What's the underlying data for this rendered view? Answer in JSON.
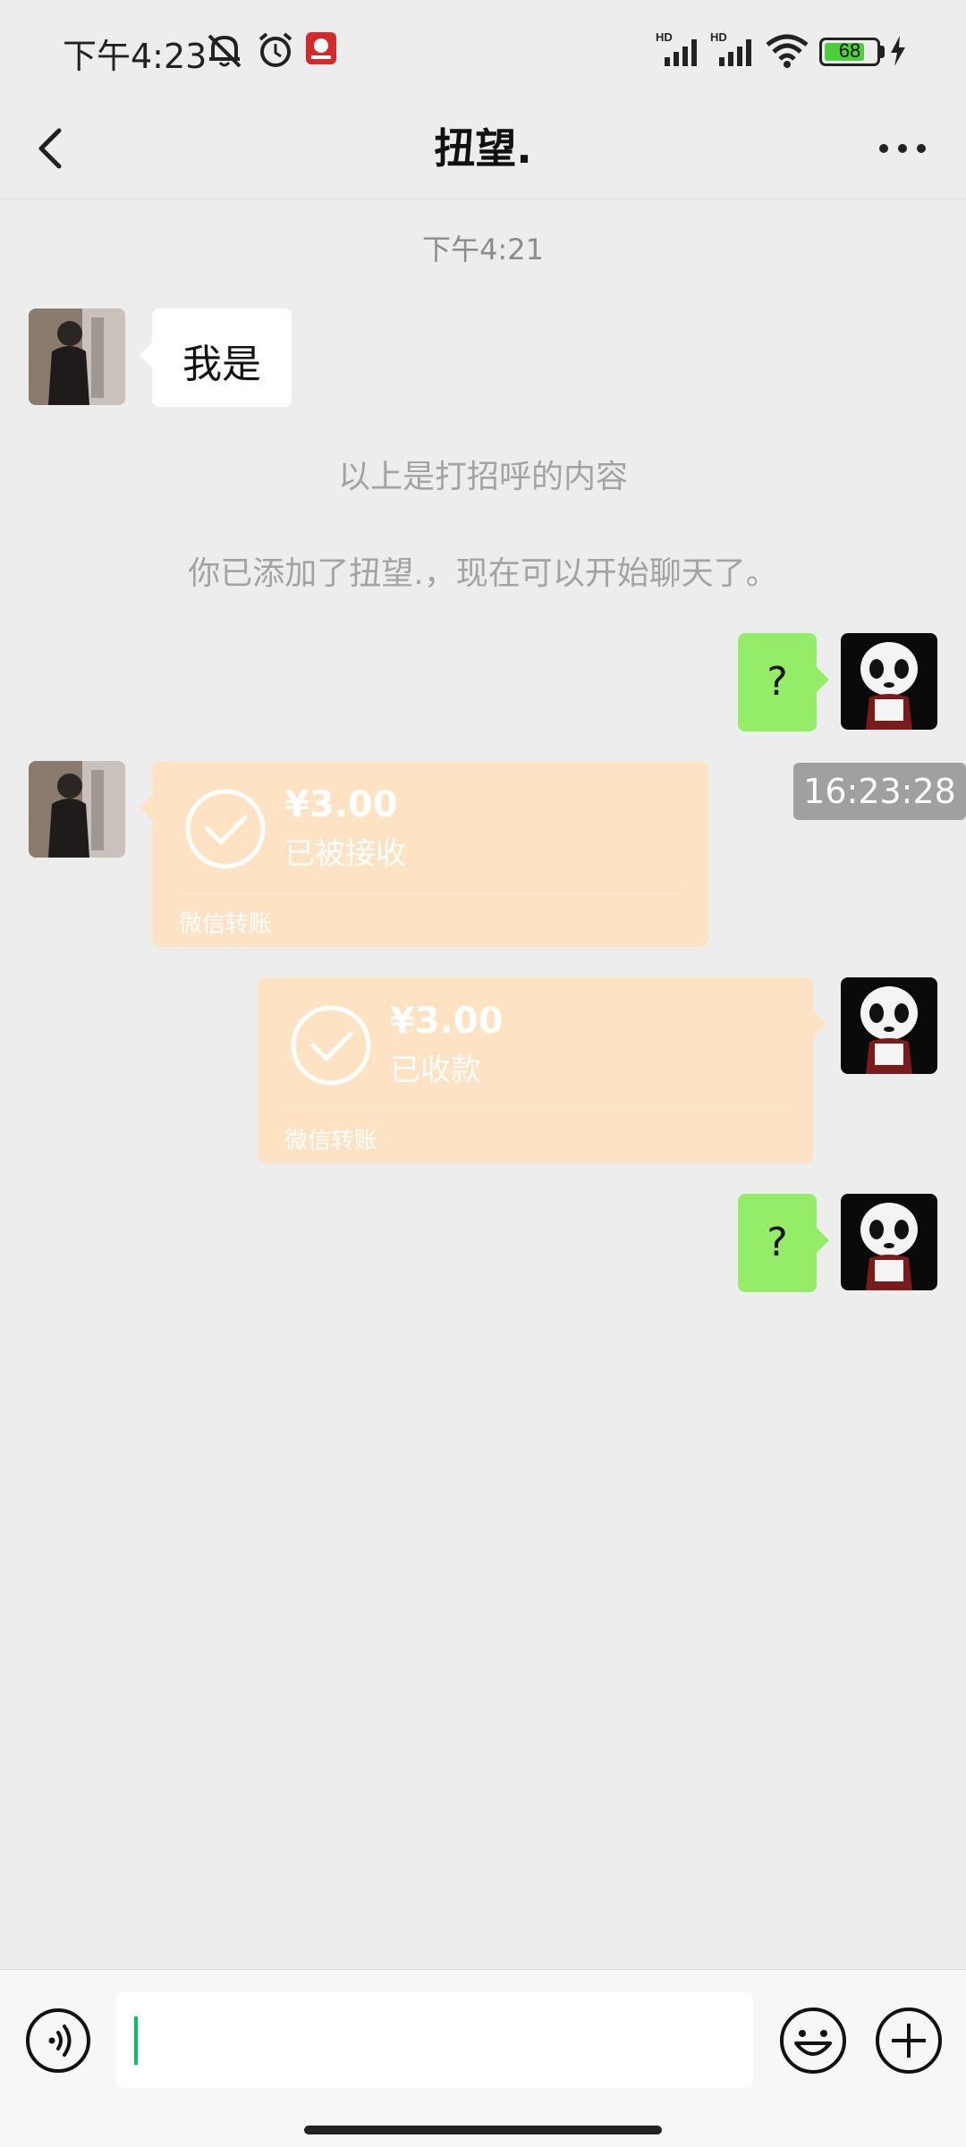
{
  "status_bar": {
    "time": "下午4:23",
    "network_1": "HD",
    "network_2": "HD",
    "battery": "68",
    "icons": [
      "mute-icon",
      "alarm-icon",
      "app-badge-icon",
      "signal-icon",
      "wifi-icon",
      "battery-icon",
      "charging-icon"
    ]
  },
  "nav": {
    "title": "扭望.",
    "back_icon": "chevron-left-icon",
    "more_icon": "more-dots-icon"
  },
  "chat": {
    "timestamp": "下午4:21",
    "greeting_text": "我是",
    "greeting_note": "以上是打招呼的内容",
    "added_note": "你已添加了扭望.，现在可以开始聊天了。",
    "question_1": "?",
    "transfer_received": {
      "amount": "¥3.00",
      "status": "已被接收",
      "label": "微信转账"
    },
    "transfer_sent": {
      "amount": "¥3.00",
      "status": "已收款",
      "label": "微信转账"
    },
    "question_2": "?",
    "time_badge": "16:23:28"
  },
  "input_bar": {
    "voice_icon": "voice-icon",
    "emoji_icon": "emoji-icon",
    "plus_icon": "plus-icon",
    "input_value": ""
  },
  "colors": {
    "background": "#ededed",
    "green_bubble": "#95ec69",
    "transfer_bubble": "#fde2c3",
    "caret": "#07c160"
  }
}
